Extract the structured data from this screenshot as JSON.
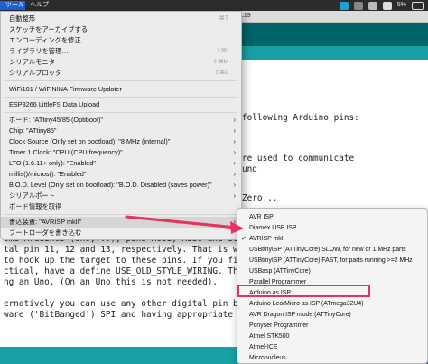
{
  "menubar": {
    "tools_label": "ツール",
    "help_label": "ヘルプ",
    "status_text": "5% ",
    "sketch_suffix": "L19"
  },
  "editor": {
    "lines_right": [
      "following Arduino pins:",
      "re used to communicate",
      "und",
      "Zero..."
    ],
    "lines_bottom": [
      "ome Arduinos (Uno,...), pins MOSI, MISO and SCK are the same",
      "tal pin 11, 12 and 13, respectively. That is why many tutorials",
      "to hook up the target to these pins. If you find this wiring more",
      "ctical, have a define USE_OLD_STYLE_WIRING. This will work even when",
      "ng an Uno. (On an Uno this is not needed).",
      "",
      "ernatively you can use any other digital pin by configuring",
      "ware ('BitBanged') SPI and having appropriate defines for"
    ]
  },
  "tools_menu": {
    "items": [
      {
        "label": "自動整形",
        "shortcut": "⌘T"
      },
      {
        "label": "スケッチをアーカイブする"
      },
      {
        "label": "エンコーディングを修正"
      },
      {
        "label": "ライブラリを管理…",
        "shortcut": "⇧⌘I"
      },
      {
        "label": "シリアルモニタ",
        "shortcut": "⇧⌘M"
      },
      {
        "label": "シリアルプロッタ",
        "shortcut": "⇧⌘L"
      },
      {
        "label": "WiFi101 / WiFiNINA Firmware Updater"
      },
      {
        "label": "ESP8266 LittleFS Data Upload"
      },
      {
        "label": "ボード: \"ATtiny45/85 (Optiboot)\""
      },
      {
        "label": "Chip: \"ATtiny85\""
      },
      {
        "label": "Clock Source (Only set on bootload): \"8 MHz (internal)\""
      },
      {
        "label": "Timer 1 Clock: \"CPU (CPU frequency)\""
      },
      {
        "label": "LTO (1.6.11+ only): \"Enabled\""
      },
      {
        "label": "millis()/micros(): \"Enabled\""
      },
      {
        "label": "B.O.D. Level (Only set on bootload): \"B.O.D. Disabled (saves power)\""
      },
      {
        "label": "シリアルポート"
      },
      {
        "label": "ボード情報を取得"
      },
      {
        "label": "書込装置: \"AVRISP mkII\""
      },
      {
        "label": "ブートローダを書き込む"
      }
    ]
  },
  "programmer_submenu": {
    "items": [
      {
        "label": "AVR ISP"
      },
      {
        "label": "Diamex USB ISP"
      },
      {
        "label": "AVRISP mkII",
        "checked": true
      },
      {
        "label": "USBtinyISP (ATTinyCore) SLOW, for new or 1 MHz parts"
      },
      {
        "label": "USBtinyISP (ATTinyCore) FAST, for parts running >=2 MHz"
      },
      {
        "label": "USBasp (ATTinyCore)"
      },
      {
        "label": "Parallel Programmer"
      },
      {
        "label": "Arduino as ISP"
      },
      {
        "label": "Arduino Leo/Micro as ISP (ATmega32U4)"
      },
      {
        "label": "AVR Dragon ISP mode (ATTinyCore)"
      },
      {
        "label": "Ponyser Programmer"
      },
      {
        "label": "Atmel STK500"
      },
      {
        "label": "Atmel-ICE"
      },
      {
        "label": "Micronucleus"
      }
    ],
    "check_glyph": "✓"
  },
  "annotation": {
    "color": "#e8325e",
    "highlighted_item": "Arduino as ISP"
  },
  "colors": {
    "toolbar": "#006468",
    "tabbar": "#17a1a5",
    "menu_bg": "#ececec"
  }
}
